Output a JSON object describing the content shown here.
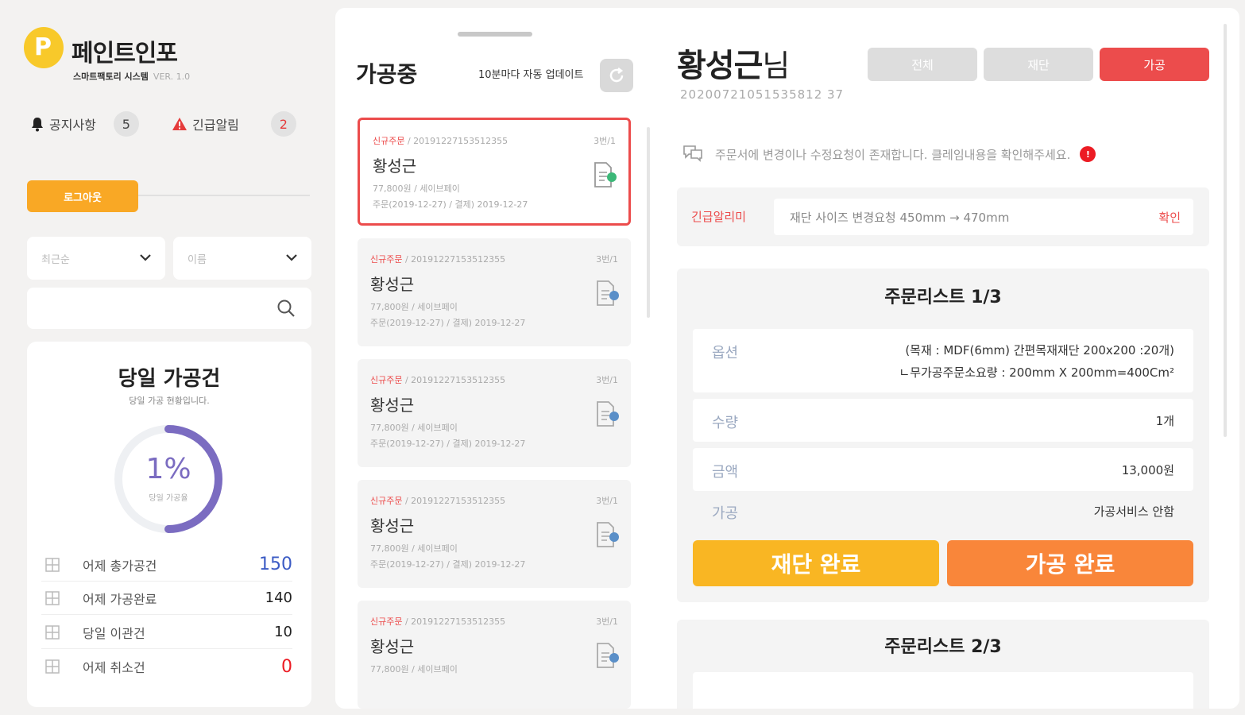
{
  "brand": {
    "name": "페인트인포",
    "subtitle": "스마트팩토리 시스템",
    "version": "VER. 1.0"
  },
  "alerts": {
    "notice_label": "공지사항",
    "notice_count": "5",
    "urgent_label": "긴급알림",
    "urgent_count": "2"
  },
  "logout_label": "로그아웃",
  "filters": {
    "sort_value": "최근순",
    "type_value": "이름"
  },
  "search": {
    "placeholder": ""
  },
  "daily": {
    "title": "당일 가공건",
    "subtitle": "당일 가공 현황입니다.",
    "percent": 1,
    "percent_label": "1%",
    "percent_caption": "당일 가공율",
    "rows": [
      {
        "label": "어제 총가공건",
        "value": "150"
      },
      {
        "label": "어제 가공완료",
        "value": "140"
      },
      {
        "label": "당일 이관건",
        "value": "10"
      },
      {
        "label": "어제 취소건",
        "value": "0"
      }
    ]
  },
  "colors": {
    "accent_red": "#ec4c4c",
    "accent_yellow": "#f9b623",
    "accent_orange": "#f9863a",
    "donut": "#7b6cc1",
    "stat_blue": "#3b5bc4"
  },
  "list": {
    "title": "가공중",
    "auto_update": "10분마다 자동 업데이트",
    "orders": [
      {
        "tag": "신규주문",
        "order_id": " / 20191227153512355",
        "count": "3번/1",
        "name": "황성근",
        "price": "77,800원 / 세이브페이",
        "dates": "주문(2019-12-27) / 결제) 2019-12-27"
      },
      {
        "tag": "신규주문",
        "order_id": " / 20191227153512355",
        "count": "3번/1",
        "name": "황성근",
        "price": "77,800원 / 세이브페이",
        "dates": "주문(2019-12-27) / 결제) 2019-12-27"
      },
      {
        "tag": "신규주문",
        "order_id": " / 20191227153512355",
        "count": "3번/1",
        "name": "황성근",
        "price": "77,800원 / 세이브페이",
        "dates": "주문(2019-12-27) / 결제) 2019-12-27"
      },
      {
        "tag": "신규주문",
        "order_id": " / 20191227153512355",
        "count": "3번/1",
        "name": "황성근",
        "price": "77,800원 / 세이브페이",
        "dates": "주문(2019-12-27) / 결제) 2019-12-27"
      },
      {
        "tag": "신규주문",
        "order_id": " / 20191227153512355",
        "count": "3번/1",
        "name": "황성근",
        "price": "77,800원 / 세이브페이",
        "dates": ""
      }
    ]
  },
  "detail": {
    "customer": "황성근",
    "suffix": "님",
    "order_no": "20200721051535812 37",
    "tabs": [
      "전체",
      "재단",
      "가공"
    ],
    "notice": "주문서에 변경이나 수정요청이 존재합니다. 클레임내용을 확인해주세요.",
    "notice_badge": "!",
    "urgent_label": "긴급알리미",
    "urgent_message": "재단 사이즈 변경요청 450mm → 470mm",
    "urgent_confirm": "확인",
    "order_list_1": "주문리스트 1/3",
    "order_list_2": "주문리스트 2/3",
    "option_key": "옵션",
    "option_line1": "(목재 : MDF(6mm) 간편목재재단 200x200 :20개)",
    "option_line2": "ㄴ무가공주문소요량 : 200mm X 200mm=400Cm²",
    "qty_key": "수량",
    "qty_value": "1개",
    "amount_key": "금액",
    "amount_value": "13,000원",
    "process_key": "가공",
    "process_value": "가공서비스 안함",
    "cut_done": "재단 완료",
    "process_done": "가공 완료"
  }
}
